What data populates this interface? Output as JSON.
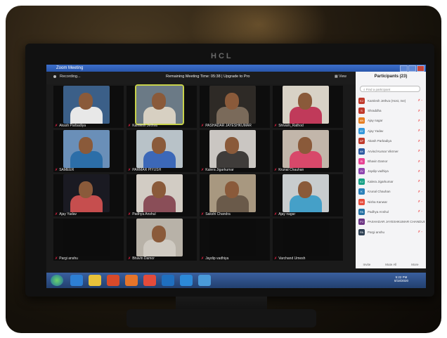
{
  "monitor_brand": "HCL",
  "window": {
    "title": "Zoom Meeting"
  },
  "topbar": {
    "recording": "Recording...",
    "remaining": "Remaining Meeting Time: 05:38 | Upgrade to Pro",
    "view": "View"
  },
  "tiles": [
    {
      "name": "Akash Parbadiya",
      "shirt": "#e8e8e8",
      "bg": "#3b5f88"
    },
    {
      "name": "Kamlesh Jethva",
      "shirt": "#d7d0c2",
      "bg": "#6b7a86",
      "active": true
    },
    {
      "name": "PASHADAR JAYESHKUMAR",
      "shirt": "#7a6a5a",
      "bg": "#2e2a26"
    },
    {
      "name": "Shivam_Rathod",
      "shirt": "#c03a5a",
      "bg": "#d8d2c6"
    },
    {
      "name": "SAMEER",
      "shirt": "#2c6ea8",
      "bg": "#6a8fb8"
    },
    {
      "name": "PARMAR PIYUSH",
      "shirt": "#3c68b8",
      "bg": "#b8c2c8"
    },
    {
      "name": "Kalera Jigarkumar",
      "shirt": "#3f3c3a",
      "bg": "#cac6c2"
    },
    {
      "name": "Krunal Chauhan",
      "shirt": "#d8486a",
      "bg": "#c2b6aa"
    },
    {
      "name": "Ajay Yadav",
      "shirt": "#c64e4e",
      "bg": "#1a1a22"
    },
    {
      "name": "Padhya Anshul",
      "shirt": "#8a4e58",
      "bg": "#d2ccc4"
    },
    {
      "name": "Sakshi Chandra",
      "shirt": "#6a5a4a",
      "bg": "#a89880"
    },
    {
      "name": "Ajay nagar",
      "shirt": "#45a0c8",
      "bg": "#c8ccce"
    },
    {
      "name": "Pargi anshu",
      "shirt": "#111",
      "bg": "#0c0c0c"
    },
    {
      "name": "Bhavin Damor",
      "shirt": "#cfcac2",
      "bg": "#b8b2a8"
    },
    {
      "name": "Jaydip vadhiya",
      "shirt": "#111",
      "bg": "#0c0c0c"
    },
    {
      "name": "Varchand Umesh",
      "shirt": "#111",
      "bg": "#0c0c0c"
    }
  ],
  "participants": {
    "title": "Participants (23)",
    "search_placeholder": "Find a participant",
    "list": [
      {
        "initials": "KJ",
        "name": "Kamlesh Jethva (Host, me)",
        "color": "#c0392b"
      },
      {
        "initials": "S",
        "name": "Shraddha",
        "color": "#c0392b"
      },
      {
        "initials": "AN",
        "name": "Ajay nagar",
        "color": "#e67e22"
      },
      {
        "initials": "AY",
        "name": "Ajay Yadav",
        "color": "#3498db"
      },
      {
        "initials": "AP",
        "name": "Akash Parbadiya",
        "color": "#c0392b"
      },
      {
        "initials": "AK",
        "name": "Arvind Kumar Vikrmer",
        "color": "#2c5aa0"
      },
      {
        "initials": "B",
        "name": "Bhavin Damor",
        "color": "#e84393"
      },
      {
        "initials": "JV",
        "name": "Jaydip vadhiya",
        "color": "#8e44ad"
      },
      {
        "initials": "KJ",
        "name": "Kalera Jigarkumar",
        "color": "#16a085"
      },
      {
        "initials": "K",
        "name": "Krunal Chauhan",
        "color": "#2980b9"
      },
      {
        "initials": "NK",
        "name": "Nisha Kanwar",
        "color": "#e74c3c"
      },
      {
        "initials": "PA",
        "name": "Padhya Anshul",
        "color": "#2471a3"
      },
      {
        "initials": "PJ",
        "name": "PASHADAR JAYESHKUMAR CHANDUBHAI",
        "color": "#6c3483"
      },
      {
        "initials": "PA",
        "name": "Pargi anshu",
        "color": "#2e4053"
      }
    ],
    "invite": "Invite",
    "mute_all": "Mute All",
    "more": "More"
  },
  "clock": {
    "time": "5:22 PM",
    "date": "8/18/2020"
  }
}
